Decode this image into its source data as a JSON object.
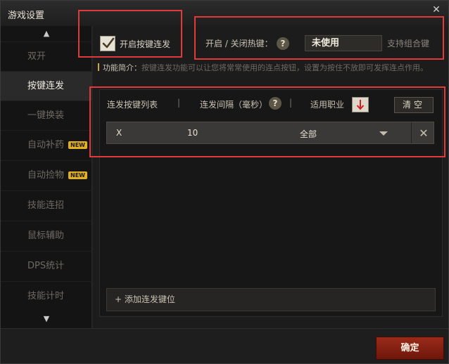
{
  "window": {
    "title": "游戏设置",
    "close_glyph": "✕"
  },
  "sidebar": {
    "items": [
      {
        "label": "双开",
        "active": false,
        "badge": ""
      },
      {
        "label": "按键连发",
        "active": true,
        "badge": ""
      },
      {
        "label": "一键换装",
        "active": false,
        "badge": ""
      },
      {
        "label": "自动补药",
        "active": false,
        "badge": "NEW"
      },
      {
        "label": "自动捡物",
        "active": false,
        "badge": "NEW"
      },
      {
        "label": "技能连招",
        "active": false,
        "badge": ""
      },
      {
        "label": "鼠标辅助",
        "active": false,
        "badge": ""
      },
      {
        "label": "DPS统计",
        "active": false,
        "badge": ""
      },
      {
        "label": "技能计时",
        "active": false,
        "badge": ""
      }
    ]
  },
  "settings": {
    "enable_label": "开启按键连发",
    "enable_checked": true,
    "hotkey_label": "开启 / 关闭热键：",
    "hotkey_value": "未使用",
    "combo_hint": "支持组合键",
    "intro_title": "功能简介：",
    "intro_text": "按键连发功能可以让您将常常使用的连点按钮，设置为按住不放即可发挥连点作用。"
  },
  "list": {
    "col_key": "连发按键列表",
    "col_interval": "连发间隔（毫秒）",
    "col_class": "适用职业",
    "separator": "|",
    "clear_label": "清空",
    "rows": [
      {
        "key": "X",
        "interval": "10",
        "class": "全部"
      }
    ],
    "add_label": "+ 添加连发键位"
  },
  "footer": {
    "ok_label": "确定"
  },
  "colors": {
    "accent_red": "#8a2214",
    "badge_yellow": "#e2b021",
    "annotation_red": "#e23a3a"
  }
}
